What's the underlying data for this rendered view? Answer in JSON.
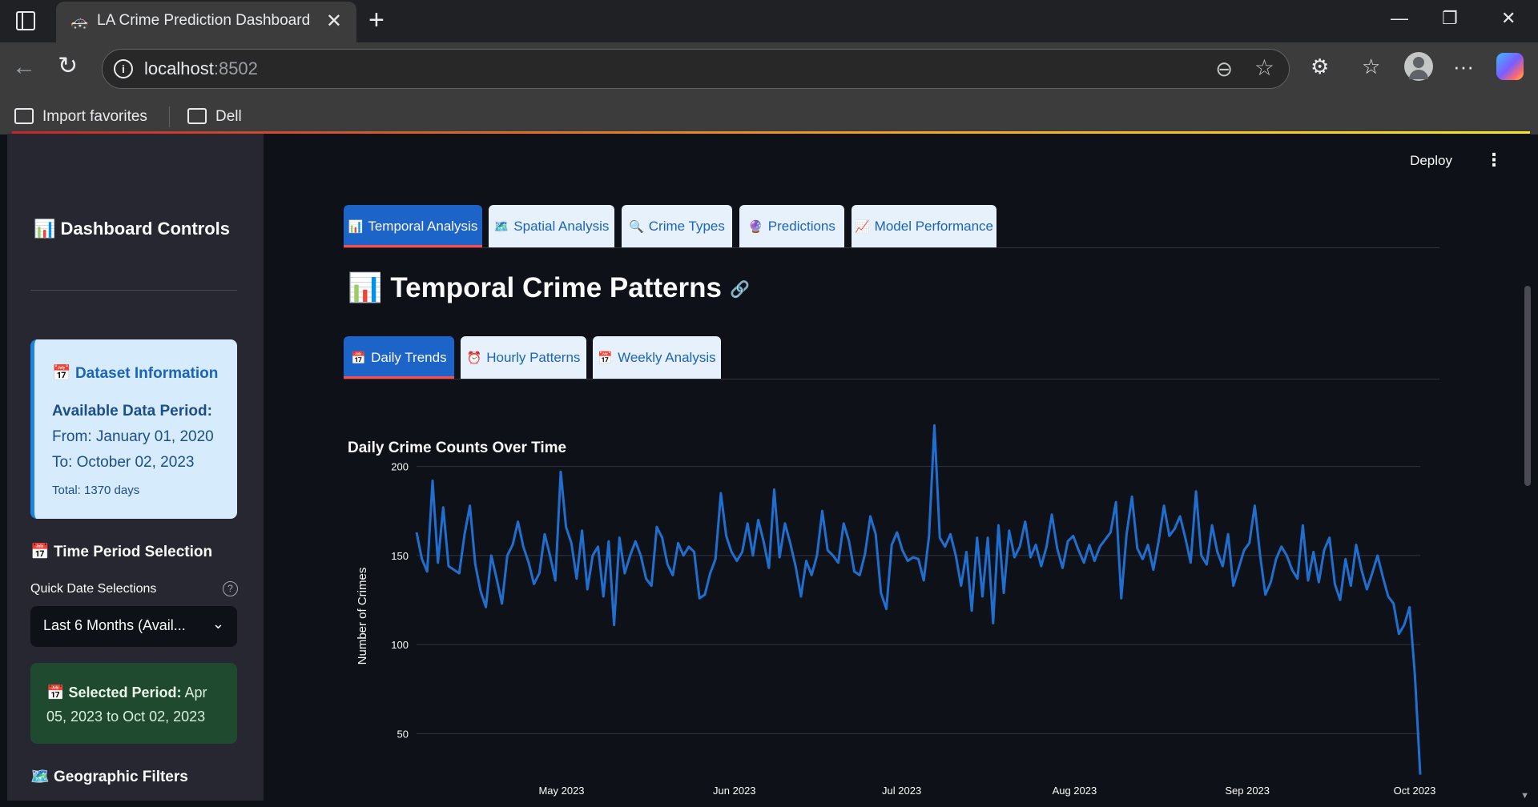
{
  "browser": {
    "tab_title": "LA Crime Prediction Dashboard",
    "url_host": "localhost",
    "url_port": ":8502",
    "bookmarks": [
      "Import favorites",
      "Dell"
    ]
  },
  "sidebar": {
    "title": "Dashboard Controls",
    "dataset_info": {
      "title": "Dataset Information",
      "label": "Available Data Period:",
      "from": "From: January 01, 2020",
      "to": "To: October 02, 2023",
      "total": "Total: 1370 days"
    },
    "time_period_title": "Time Period Selection",
    "quick_label": "Quick Date Selections",
    "quick_value": "Last 6 Months (Avail...",
    "selected_label": "Selected Period:",
    "selected_value": "Apr 05, 2023 to Oct 02, 2023",
    "geo_title": "Geographic Filters"
  },
  "header": {
    "deploy": "Deploy"
  },
  "main_tabs": [
    "Temporal Analysis",
    "Spatial Analysis",
    "Crime Types",
    "Predictions",
    "Model Performance"
  ],
  "page_title": "Temporal Crime Patterns",
  "sub_tabs": [
    "Daily Trends",
    "Hourly Patterns",
    "Weekly Analysis"
  ],
  "chart_title": "Daily Crime Counts Over Time",
  "colors": {
    "accent": "#1c64c8",
    "line": "#1f6fd1",
    "tab_underline": "#ff4b4b"
  },
  "chart_data": {
    "type": "line",
    "title": "Daily Crime Counts Over Time",
    "xlabel": "",
    "ylabel": "Number of Crimes",
    "x_start": "2023-04-05",
    "x_end": "2023-10-02",
    "x_ticks": [
      "May 2023",
      "Jun 2023",
      "Jul 2023",
      "Aug 2023",
      "Sep 2023",
      "Oct 2023"
    ],
    "y_ticks": [
      50,
      100,
      150,
      200
    ],
    "ylim": [
      25,
      225
    ],
    "grid": true,
    "series": [
      {
        "values": [
          163,
          148,
          141,
          192,
          146,
          177,
          144,
          142,
          140,
          162,
          178,
          145,
          130,
          121,
          150,
          137,
          123,
          150,
          156,
          169,
          155,
          146,
          134,
          140,
          162,
          150,
          136,
          197,
          166,
          157,
          137,
          164,
          131,
          150,
          155,
          127,
          158,
          111,
          160,
          140,
          150,
          158,
          150,
          137,
          133,
          166,
          160,
          145,
          139,
          157,
          150,
          155,
          152,
          126,
          128,
          140,
          148,
          185,
          161,
          152,
          147,
          152,
          168,
          150,
          170,
          158,
          143,
          187,
          149,
          168,
          157,
          144,
          127,
          147,
          139,
          150,
          175,
          153,
          150,
          146,
          168,
          158,
          141,
          139,
          151,
          172,
          162,
          129,
          120,
          156,
          163,
          153,
          147,
          149,
          148,
          136,
          161,
          223,
          160,
          155,
          162,
          150,
          133,
          152,
          119,
          160,
          127,
          160,
          112,
          167,
          129,
          164,
          149,
          155,
          169,
          149,
          156,
          144,
          155,
          173,
          154,
          143,
          158,
          161,
          153,
          146,
          156,
          147,
          155,
          159,
          163,
          180,
          126,
          162,
          183,
          154,
          148,
          156,
          142,
          158,
          178,
          161,
          165,
          172,
          160,
          146,
          186,
          150,
          145,
          167,
          152,
          144,
          162,
          133,
          143,
          153,
          157,
          178,
          150,
          128,
          135,
          148,
          155,
          150,
          142,
          137,
          167,
          136,
          152,
          135,
          153,
          160,
          134,
          125,
          148,
          133,
          156,
          142,
          131,
          140,
          150,
          138,
          127,
          123,
          106,
          111,
          121,
          83,
          27
        ]
      }
    ]
  }
}
